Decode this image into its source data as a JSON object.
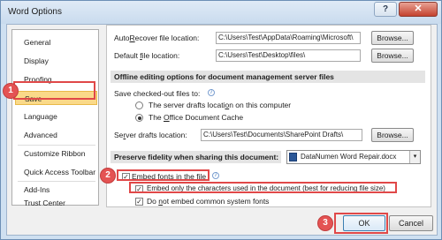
{
  "window": {
    "title": "Word Options"
  },
  "title_buttons": {
    "help": "?",
    "close": "✕"
  },
  "sidebar": {
    "items": [
      {
        "label": "General"
      },
      {
        "label": "Display"
      },
      {
        "label": "Proofing"
      },
      {
        "label": "Save"
      },
      {
        "label": "Language"
      },
      {
        "label": "Advanced"
      },
      {
        "label": "Customize Ribbon"
      },
      {
        "label": "Quick Access Toolbar"
      },
      {
        "label": "Add-Ins"
      },
      {
        "label": "Trust Center"
      }
    ]
  },
  "save": {
    "autorecover_label": "AutoRecover file location:",
    "autorecover_value": "C:\\Users\\Test\\AppData\\Roaming\\Microsoft\\",
    "default_label": "Default file location:",
    "default_value": "C:\\Users\\Test\\Desktop\\files\\",
    "browse_label": "Browse...",
    "offline_section": "Offline editing options for document management server files",
    "save_checkedout_label": "Save checked-out files to:",
    "radio_server": "The server drafts location on this computer",
    "radio_cache": "The Office Document Cache",
    "server_drafts_label": "Server drafts location:",
    "server_drafts_value": "C:\\Users\\Test\\Documents\\SharePoint Drafts\\",
    "fidelity_section": "Preserve fidelity when sharing this document:",
    "fidelity_doc": "DataNumen Word Repair.docx",
    "embed_fonts": "Embed fonts in the file",
    "embed_only": "Embed only the characters used in the document (best for reducing file size)",
    "no_common": "Do not embed common system fonts"
  },
  "state": {
    "radio_server_checked": false,
    "radio_cache_checked": true,
    "embed_fonts_checked": true,
    "embed_only_checked": true,
    "no_common_checked": true,
    "selected_nav": "Save"
  },
  "callouts": {
    "one": "1",
    "two": "2",
    "three": "3"
  },
  "footer": {
    "ok": "OK",
    "cancel": "Cancel"
  },
  "colors": {
    "callout": "#e04848",
    "nav_selected": "#fad989",
    "title_close": "#c4422f"
  },
  "icons": {
    "check": "✓",
    "dropdown": "▾",
    "info": "i"
  }
}
